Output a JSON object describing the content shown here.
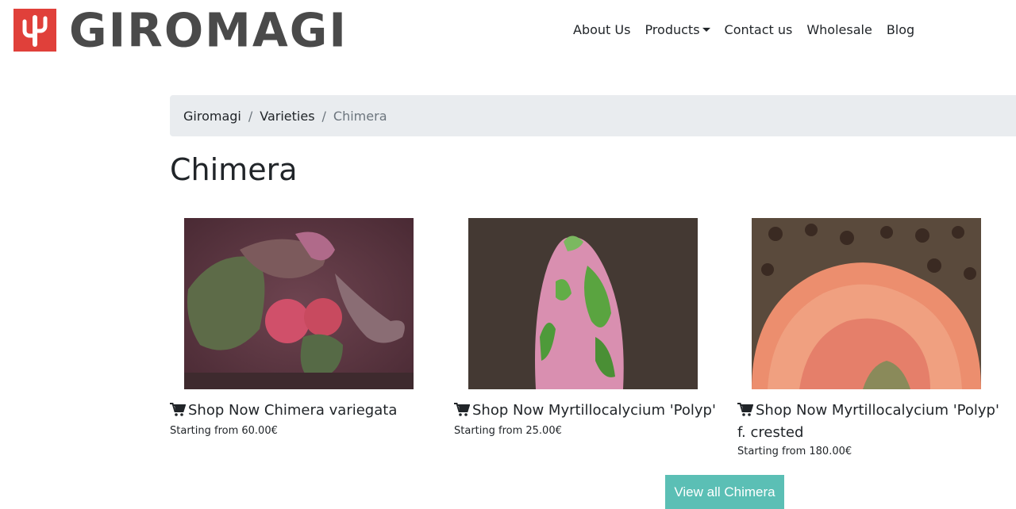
{
  "brand": {
    "name": "GIROMAGI",
    "color": "#e0403a"
  },
  "nav": {
    "items": [
      "About Us",
      "Products",
      "Contact us",
      "Wholesale",
      "Blog"
    ]
  },
  "breadcrumb": {
    "items": [
      "Giromagi",
      "Varieties"
    ],
    "active": "Chimera"
  },
  "page": {
    "title": "Chimera"
  },
  "products": [
    {
      "title": "Shop  Now Chimera variegata",
      "price": "Starting from 60.00€",
      "image": "chimera-variegata-photo"
    },
    {
      "title": "Shop  Now  Myrtillocalycium 'Polyp'",
      "price": "Starting from 25.00€",
      "image": "myrtillocalycium-polyp-photo"
    },
    {
      "title": "Shop  Now  Myrtillocalycium 'Polyp' f. crested",
      "price": "Starting from 180.00€",
      "image": "myrtillocalycium-polyp-crested-photo"
    }
  ],
  "cta": {
    "label": "View all Chimera",
    "color": "#5bbfb5"
  },
  "icons": {
    "cart": "shopping-cart-icon",
    "logo": "cactus-logo-icon"
  }
}
